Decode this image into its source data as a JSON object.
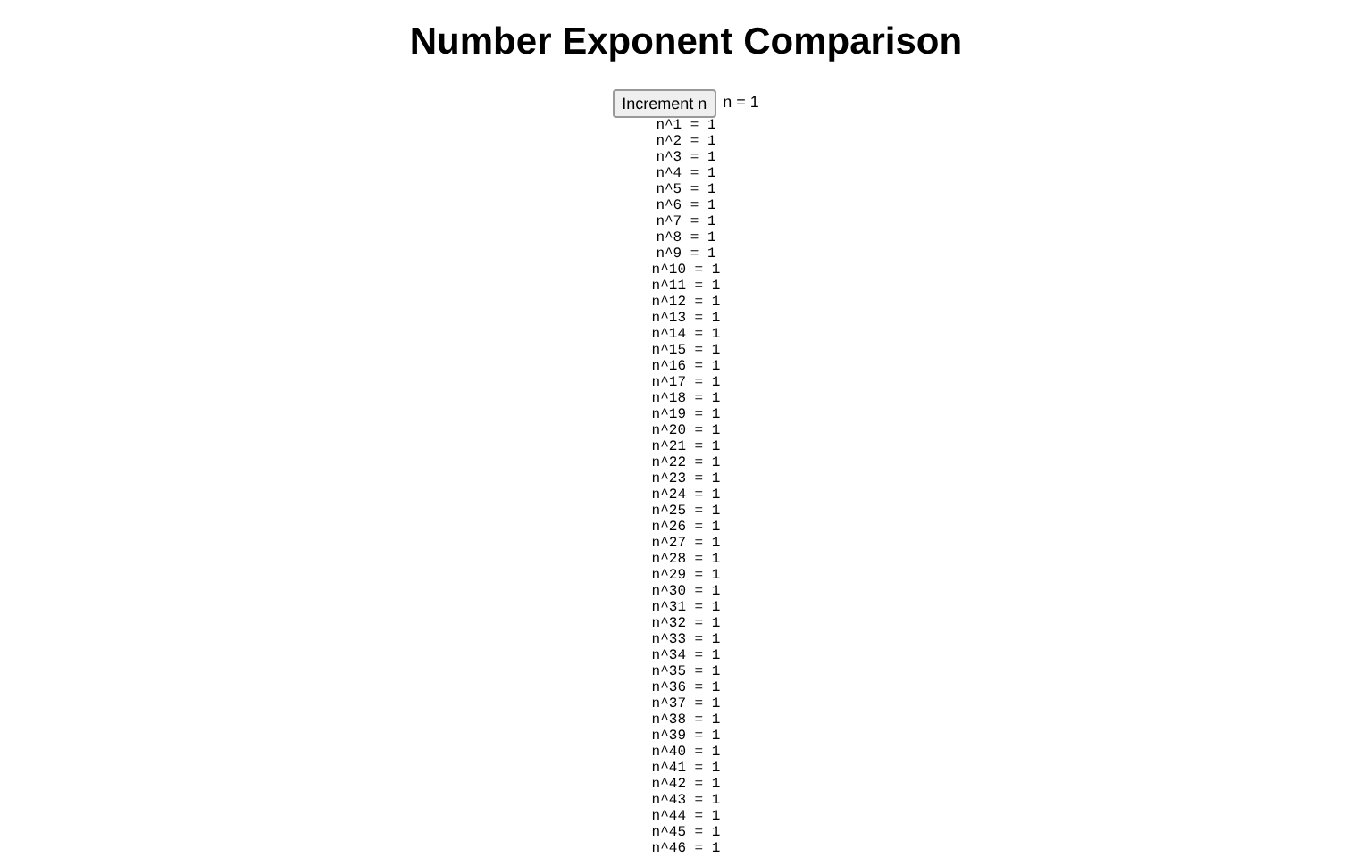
{
  "title": "Number Exponent Comparison",
  "button": "Increment n",
  "counter": "n = 1",
  "rows": [
    "n^1 = 1",
    "n^2 = 1",
    "n^3 = 1",
    "n^4 = 1",
    "n^5 = 1",
    "n^6 = 1",
    "n^7 = 1",
    "n^8 = 1",
    "n^9 = 1",
    "n^10 = 1",
    "n^11 = 1",
    "n^12 = 1",
    "n^13 = 1",
    "n^14 = 1",
    "n^15 = 1",
    "n^16 = 1",
    "n^17 = 1",
    "n^18 = 1",
    "n^19 = 1",
    "n^20 = 1",
    "n^21 = 1",
    "n^22 = 1",
    "n^23 = 1",
    "n^24 = 1",
    "n^25 = 1",
    "n^26 = 1",
    "n^27 = 1",
    "n^28 = 1",
    "n^29 = 1",
    "n^30 = 1",
    "n^31 = 1",
    "n^32 = 1",
    "n^33 = 1",
    "n^34 = 1",
    "n^35 = 1",
    "n^36 = 1",
    "n^37 = 1",
    "n^38 = 1",
    "n^39 = 1",
    "n^40 = 1",
    "n^41 = 1",
    "n^42 = 1",
    "n^43 = 1",
    "n^44 = 1",
    "n^45 = 1",
    "n^46 = 1"
  ]
}
